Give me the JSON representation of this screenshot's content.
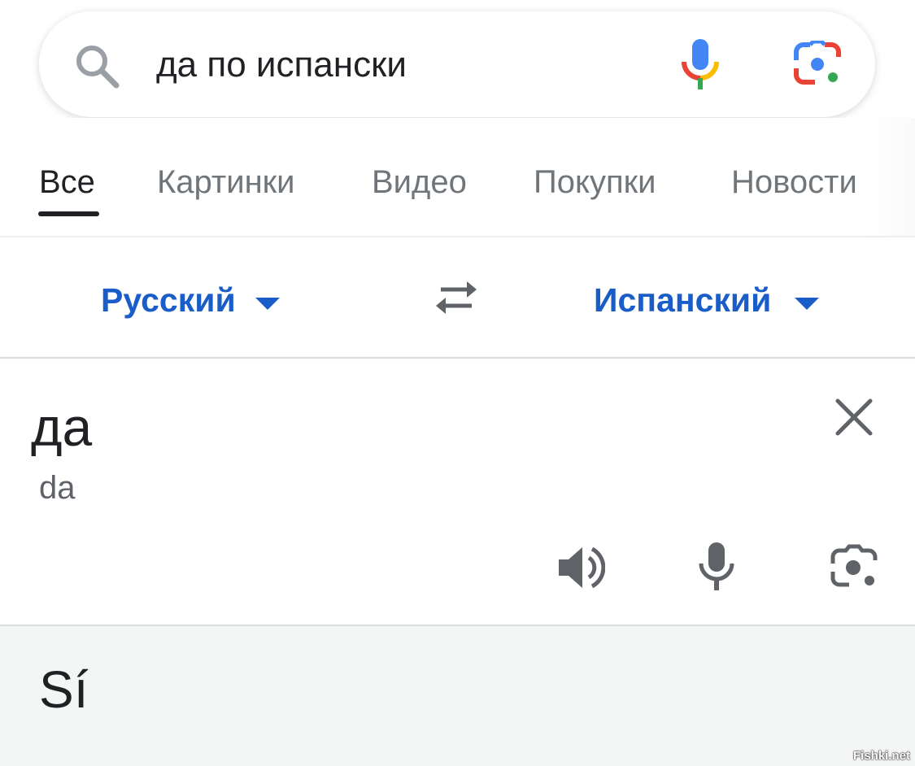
{
  "search": {
    "query": "да по испански",
    "icons": {
      "search": "search-icon",
      "voice": "microphone-icon",
      "lens": "camera-lens-icon"
    }
  },
  "tabs": [
    {
      "label": "Все",
      "active": true
    },
    {
      "label": "Картинки",
      "active": false
    },
    {
      "label": "Видео",
      "active": false
    },
    {
      "label": "Покупки",
      "active": false
    },
    {
      "label": "Новости",
      "active": false
    }
  ],
  "translator": {
    "source_language": "Русский",
    "target_language": "Испанский",
    "source_text": "да",
    "source_transliteration": "da",
    "target_text": "Sí",
    "colors": {
      "language_link": "#1a5dc8",
      "result_background": "#f4f5f5"
    }
  },
  "watermark": "Fishki.net"
}
